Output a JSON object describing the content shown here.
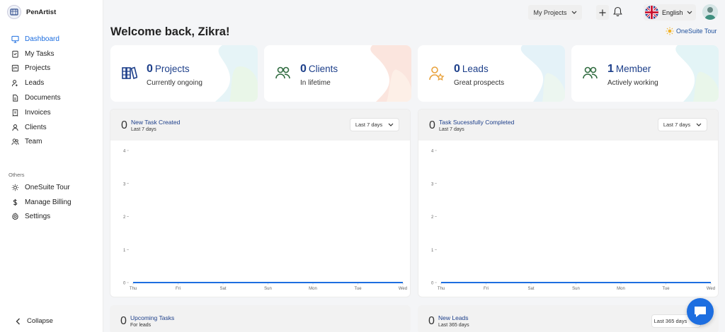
{
  "app": {
    "name": "PenArtist"
  },
  "sidebar": {
    "items": [
      {
        "label": "Dashboard",
        "icon": "monitor-icon",
        "active": true
      },
      {
        "label": "My Tasks",
        "icon": "clipboard-icon"
      },
      {
        "label": "Projects",
        "icon": "kanban-icon"
      },
      {
        "label": "Leads",
        "icon": "user-plus-icon"
      },
      {
        "label": "Documents",
        "icon": "file-icon"
      },
      {
        "label": "Invoices",
        "icon": "receipt-icon"
      },
      {
        "label": "Clients",
        "icon": "user-icon"
      },
      {
        "label": "Team",
        "icon": "users-icon"
      }
    ],
    "others_label": "Others",
    "others": [
      {
        "label": "OneSuite Tour",
        "icon": "sun-icon"
      },
      {
        "label": "Manage Billing",
        "icon": "dollar-icon"
      },
      {
        "label": "Settings",
        "icon": "gear-icon"
      }
    ],
    "collapse_label": "Collapse"
  },
  "topbar": {
    "projects_selector": "My Projects",
    "language": "English"
  },
  "welcome": "Welcome back, Zikra!",
  "tour_link": "OneSuite Tour",
  "stats": [
    {
      "count": "0",
      "label": "Projects",
      "sub": "Currently ongoing",
      "icon": "books-icon",
      "color": "#1d3f8a"
    },
    {
      "count": "0",
      "label": "Clients",
      "sub": "In lifetime",
      "icon": "users-icon",
      "color": "#2f6b3f"
    },
    {
      "count": "0",
      "label": "Leads",
      "sub": "Great prospects",
      "icon": "user-star-icon",
      "color": "#e8a13a"
    },
    {
      "count": "1",
      "label": "Member",
      "sub": "Actively working",
      "icon": "users-icon",
      "color": "#2f6b3f"
    }
  ],
  "panels": [
    {
      "count": "0",
      "title": "New Task Created",
      "sub": "Last 7 days",
      "range": "Last 7 days"
    },
    {
      "count": "0",
      "title": "Task Sucessfully Completed",
      "sub": "Last 7 days",
      "range": "Last 7 days"
    }
  ],
  "bottom_panels": [
    {
      "count": "0",
      "title": "Upcoming Tasks",
      "sub": "For leads"
    },
    {
      "count": "0",
      "title": "New Leads",
      "sub": "Last 365 days",
      "range": "Last 365 days"
    }
  ],
  "chart_data": [
    {
      "type": "line",
      "categories": [
        "Thu",
        "Fri",
        "Sat",
        "Sun",
        "Mon",
        "Tue",
        "Wed"
      ],
      "series": [
        {
          "values": [
            0,
            0,
            0,
            0,
            0,
            0,
            0
          ]
        }
      ],
      "yticks": [
        0,
        1,
        2,
        3,
        4
      ],
      "ylim": [
        0,
        4
      ],
      "color": "#1d6ee0"
    },
    {
      "type": "line",
      "categories": [
        "Thu",
        "Fri",
        "Sat",
        "Sun",
        "Mon",
        "Tue",
        "Wed"
      ],
      "series": [
        {
          "values": [
            0,
            0,
            0,
            0,
            0,
            0,
            0
          ]
        }
      ],
      "yticks": [
        0,
        1,
        2,
        3,
        4
      ],
      "ylim": [
        0,
        4
      ],
      "color": "#1d6ee0"
    }
  ]
}
